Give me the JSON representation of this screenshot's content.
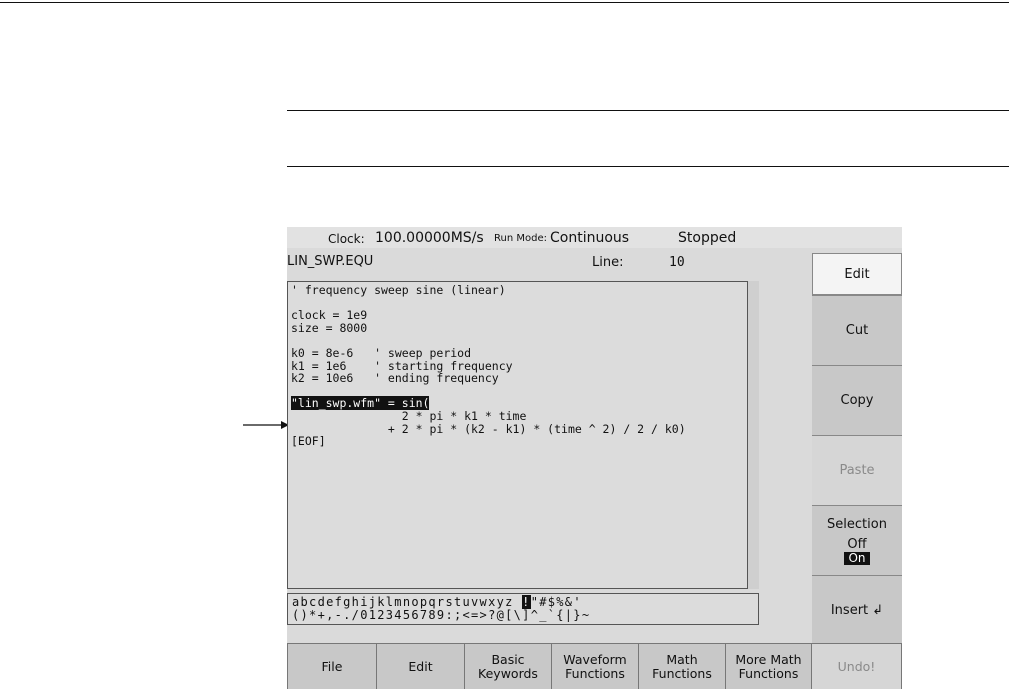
{
  "status": {
    "clock_label": "Clock:",
    "clock_value": "100.00000MS/s",
    "runmode_label": "Run Mode:",
    "runmode_value": "Continuous",
    "state": "Stopped"
  },
  "editor": {
    "filename": "LIN_SWP.EQU",
    "line_label": "Line:",
    "line_value": "10",
    "code_lines": [
      "' frequency sweep sine (linear)",
      "",
      "clock = 1e9",
      "size = 8000",
      "",
      "k0 = 8e-6   ' sweep period",
      "k1 = 1e6    ' starting frequency",
      "k2 = 10e6   ' ending frequency",
      "",
      "\"lin_swp.wfm\" = sin(",
      "                2 * pi * k1 * time",
      "              + 2 * pi * (k2 - k1) * (time ^ 2) / 2 / k0)",
      "[EOF]"
    ]
  },
  "charbar": {
    "row1_a": "abcdefghijklmnopqrstuvwxyz ",
    "row1_cursor": "!",
    "row1_b": "\"#$%&'",
    "row2": "()*+,-./0123456789:;<=>?@[\\]^_`{|}~"
  },
  "side_menu": {
    "edit": "Edit",
    "cut": "Cut",
    "copy": "Copy",
    "paste": "Paste",
    "selection": "Selection",
    "selection_off": "Off",
    "selection_on": "On",
    "insert": "Insert ↲"
  },
  "bottom_menu": {
    "file": "File",
    "edit": "Edit",
    "basic_1": "Basic",
    "basic_2": "Keywords",
    "waveform_1": "Waveform",
    "waveform_2": "Functions",
    "math_1": "Math",
    "math_2": "Functions",
    "moremath_1": "More Math",
    "moremath_2": "Functions",
    "undo": "Undo!"
  },
  "colors": {
    "screen_bg": "#dadada",
    "button_bg": "#c8c8c8",
    "highlight": "#111111"
  }
}
